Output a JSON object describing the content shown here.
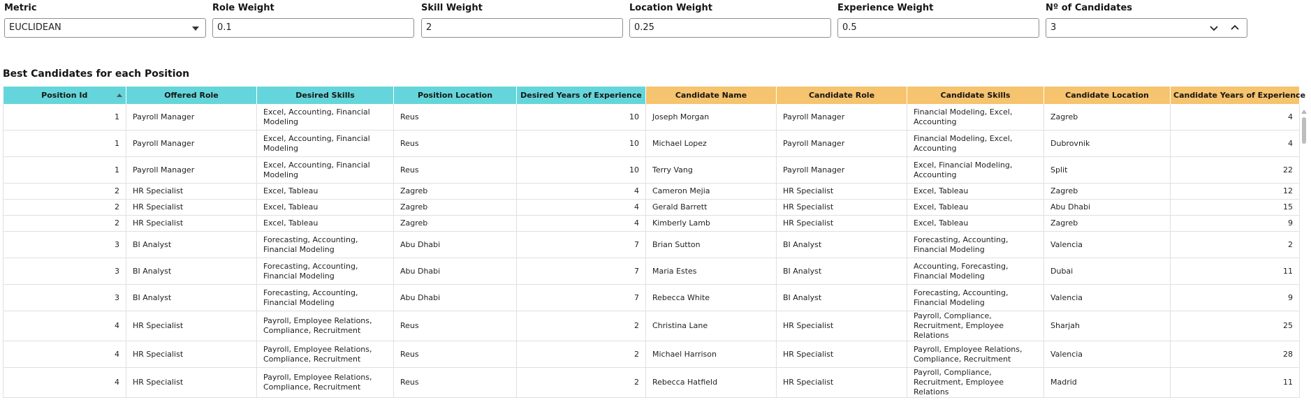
{
  "params": {
    "metric": {
      "label": "Metric",
      "value": "EUCLIDEAN"
    },
    "role_weight": {
      "label": "Role Weight",
      "value": "0.1"
    },
    "skill_weight": {
      "label": "Skill Weight",
      "value": "2"
    },
    "location_weight": {
      "label": "Location Weight",
      "value": "0.25"
    },
    "experience_weight": {
      "label": "Experience Weight",
      "value": "0.5"
    },
    "num_candidates": {
      "label": "Nº of Candidates",
      "value": "3"
    }
  },
  "table": {
    "title": "Best Candidates for each Position",
    "columns": [
      "Position Id",
      "Offered Role",
      "Desired Skills",
      "Position Location",
      "Desired Years of Experience",
      "Candidate Name",
      "Candidate Role",
      "Candidate Skills",
      "Candidate Location",
      "Candidate Years of Experience"
    ],
    "rows": [
      [
        "1",
        "Payroll Manager",
        "Excel, Accounting, Financial Modeling",
        "Reus",
        "10",
        "Joseph Morgan",
        "Payroll Manager",
        "Financial Modeling, Excel, Accounting",
        "Zagreb",
        "4"
      ],
      [
        "1",
        "Payroll Manager",
        "Excel, Accounting, Financial Modeling",
        "Reus",
        "10",
        "Michael Lopez",
        "Payroll Manager",
        "Financial Modeling, Excel, Accounting",
        "Dubrovnik",
        "4"
      ],
      [
        "1",
        "Payroll Manager",
        "Excel, Accounting, Financial Modeling",
        "Reus",
        "10",
        "Terry Vang",
        "Payroll Manager",
        "Excel, Financial Modeling, Accounting",
        "Split",
        "22"
      ],
      [
        "2",
        "HR Specialist",
        "Excel, Tableau",
        "Zagreb",
        "4",
        "Cameron Mejia",
        "HR Specialist",
        "Excel, Tableau",
        "Zagreb",
        "12"
      ],
      [
        "2",
        "HR Specialist",
        "Excel, Tableau",
        "Zagreb",
        "4",
        "Gerald Barrett",
        "HR Specialist",
        "Excel, Tableau",
        "Abu Dhabi",
        "15"
      ],
      [
        "2",
        "HR Specialist",
        "Excel, Tableau",
        "Zagreb",
        "4",
        "Kimberly Lamb",
        "HR Specialist",
        "Excel, Tableau",
        "Zagreb",
        "9"
      ],
      [
        "3",
        "BI Analyst",
        "Forecasting, Accounting, Financial Modeling",
        "Abu Dhabi",
        "7",
        "Brian Sutton",
        "BI Analyst",
        "Forecasting, Accounting, Financial Modeling",
        "Valencia",
        "2"
      ],
      [
        "3",
        "BI Analyst",
        "Forecasting, Accounting, Financial Modeling",
        "Abu Dhabi",
        "7",
        "Maria Estes",
        "BI Analyst",
        "Accounting, Forecasting, Financial Modeling",
        "Dubai",
        "11"
      ],
      [
        "3",
        "BI Analyst",
        "Forecasting, Accounting, Financial Modeling",
        "Abu Dhabi",
        "7",
        "Rebecca White",
        "BI Analyst",
        "Forecasting, Accounting, Financial Modeling",
        "Valencia",
        "9"
      ],
      [
        "4",
        "HR Specialist",
        "Payroll, Employee Relations, Compliance, Recruitment",
        "Reus",
        "2",
        "Christina Lane",
        "HR Specialist",
        "Payroll, Compliance, Recruitment, Employee Relations",
        "Sharjah",
        "25"
      ],
      [
        "4",
        "HR Specialist",
        "Payroll, Employee Relations, Compliance, Recruitment",
        "Reus",
        "2",
        "Michael Harrison",
        "HR Specialist",
        "Payroll, Employee Relations, Compliance, Recruitment",
        "Valencia",
        "28"
      ],
      [
        "4",
        "HR Specialist",
        "Payroll, Employee Relations, Compliance, Recruitment",
        "Reus",
        "2",
        "Rebecca Hatfield",
        "HR Specialist",
        "Payroll, Compliance, Recruitment, Employee Relations",
        "Madrid",
        "11"
      ]
    ]
  },
  "colors": {
    "position_header": "#64d6db",
    "candidate_header": "#f6c36e"
  }
}
